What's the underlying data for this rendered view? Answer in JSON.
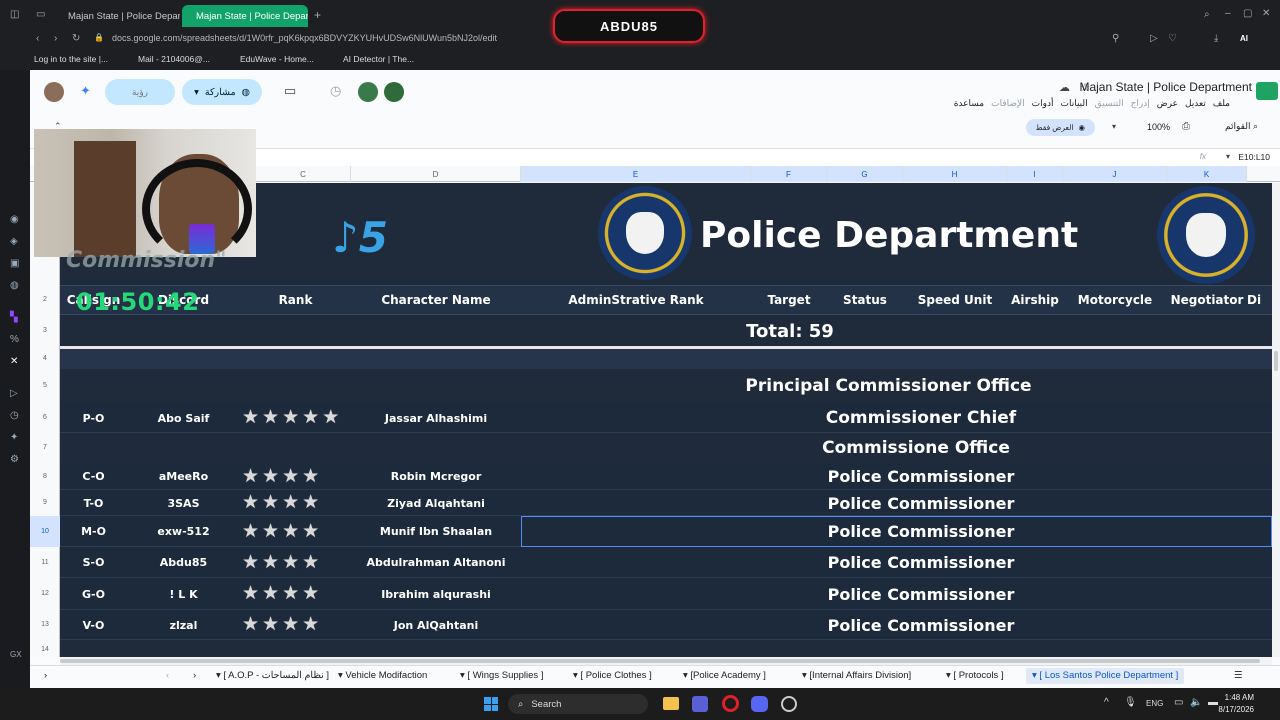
{
  "browser": {
    "tabs": [
      {
        "label": "Majan State | Police Depart"
      },
      {
        "label": "Majan State | Police Depart"
      }
    ],
    "url": "docs.google.com/spreadsheets/d/1W0rfr_pqK6kpqx6BDVYZKYUHvUDSw6NlUWun5bNJ2ol/edit",
    "bookmarks": [
      "Log in to the site |...",
      "Mail - 2104006@...",
      "EduWave - Home...",
      "AI Detector | The..."
    ],
    "profile_label": "AI"
  },
  "stream": {
    "badge": "ABDU85",
    "timer": "01:50:42",
    "overlay_text": "Commission\""
  },
  "sheets": {
    "title": "Majan State | Police Department",
    "menus": [
      "ملف",
      "تعديل",
      "عرض",
      "إدراج",
      "التنسيق",
      "البيانات",
      "أدوات",
      "الإضافات",
      "مساعدة"
    ],
    "share_label": "مشاركة",
    "roa_label": "رؤية",
    "view_only_label": "العرض فقط",
    "zoom": "100%",
    "menus_search": "القوائم",
    "namebox": "E10:L10",
    "fx": "fx",
    "columns": [
      "C",
      "D",
      "E",
      "F",
      "G",
      "H",
      "I",
      "J",
      "K"
    ],
    "row_numbers": [
      "2",
      "3",
      "4",
      "5",
      "6",
      "7",
      "8",
      "9",
      "10",
      "11",
      "12",
      "13",
      "14"
    ]
  },
  "roster": {
    "banner_title": "Police Department",
    "headers": [
      "Callsign",
      "Discord",
      "Rank",
      "Character Name",
      "AdminStrative Rank",
      "Target",
      "Status",
      "Speed Unit",
      "Airship",
      "Motorcycle",
      "Negotiator",
      "Di"
    ],
    "total": "Total: 59",
    "section_principal": "Principal Commissioner Office",
    "section_office": "Commissione Office",
    "chief": {
      "callsign": "P-O",
      "discord": "Abo Saif",
      "stars": 5,
      "name": "Jassar Alhashimi",
      "rank": "Commissioner Chief"
    },
    "members": [
      {
        "callsign": "C-O",
        "discord": "aMeeRo",
        "stars": 4,
        "name": "Robin Mcregor",
        "rank": "Police Commissioner"
      },
      {
        "callsign": "T-O",
        "discord": "3SAS",
        "stars": 4,
        "name": "Ziyad Alqahtani",
        "rank": "Police Commissioner"
      },
      {
        "callsign": "M-O",
        "discord": "exw-512",
        "stars": 4,
        "name": "Munif Ibn Shaalan",
        "rank": "Police Commissioner"
      },
      {
        "callsign": "S-O",
        "discord": "Abdu85",
        "stars": 4,
        "name": "Abdulrahman Altanoni",
        "rank": "Police Commissioner"
      },
      {
        "callsign": "G-O",
        "discord": "! L K",
        "stars": 4,
        "name": "Ibrahim alqurashi",
        "rank": "Police Commissioner"
      },
      {
        "callsign": "V-O",
        "discord": "zlzal",
        "stars": 4,
        "name": "Jon AlQahtani",
        "rank": "Police Commissioner"
      }
    ]
  },
  "sheet_tabs": [
    "[ A.O.P - نظام المساحات ]",
    "Vehicle Modifaction",
    "[ Wings Supplies ]",
    "[ Police Clothes ]",
    "[Police Academy ]",
    "[Internal Affairs Division]",
    "[ Protocols ]",
    "[ Los Santos Police Department ]"
  ],
  "taskbar": {
    "search": "Search",
    "lang": "ENG",
    "time": "1:48 AM",
    "date": "8/17/2026"
  }
}
